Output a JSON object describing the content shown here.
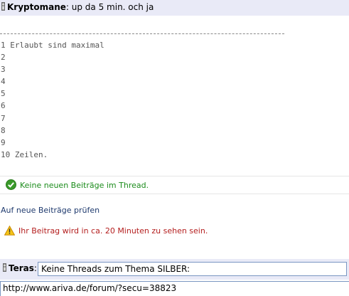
{
  "post": {
    "author": "Kryptomane",
    "separator": ":",
    "text": " up da 5 min. och ja",
    "user_icon": "user-silhouette-icon",
    "signature_lines": [
      "1 Erlaubt sind maximal",
      "2",
      "3",
      "4",
      "5",
      "6",
      "7",
      "8",
      "9",
      "10 Zeilen."
    ]
  },
  "notice": {
    "icon": "green-check-icon",
    "text": "Keine neuen Beiträge im Thread.",
    "color": "#1c8c1c"
  },
  "check_link": {
    "label": "Auf neue Beiträge prüfen"
  },
  "warning": {
    "icon": "warning-triangle-icon",
    "text": "Ihr Beitrag wird in ca. 20 Minuten zu sehen sein.",
    "color": "#b41e1e"
  },
  "reply": {
    "author": "Teras",
    "separator": ":",
    "title_value": "Keine Threads zum Thema SILBER:",
    "body_value": "http://www.ariva.de/forum/?secu=38823"
  },
  "colors": {
    "header_bg": "#e9eaf7",
    "link": "#1f3a6e",
    "input_border": "#7a96c2"
  }
}
